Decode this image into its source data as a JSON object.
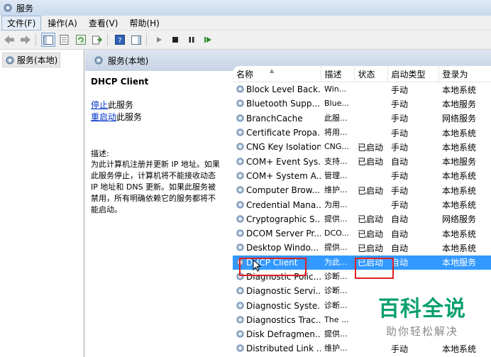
{
  "window": {
    "title": "服务"
  },
  "menu": [
    "文件(F)",
    "操作(A)",
    "查看(V)",
    "帮助(H)"
  ],
  "tree": {
    "item": "服务(本地)"
  },
  "content_header": {
    "title": "服务(本地)"
  },
  "detail": {
    "service_name": "DHCP Client",
    "stop_link": "停止",
    "stop_suffix": "此服务",
    "restart_link": "重启动",
    "restart_suffix": "此服务",
    "desc_label": "描述:",
    "desc_lines": [
      "为此计算机注册并更新 IP 地址。如果",
      "此服务停止，计算机将不能接收动态",
      "IP 地址和 DNS 更新。如果此服务被",
      "禁用，所有明确依赖它的服务都将不",
      "能启动。"
    ]
  },
  "table": {
    "headers": [
      "名称",
      "描述",
      "状态",
      "启动类型",
      "登录为"
    ],
    "rows": [
      [
        "Block Level Back...",
        "Win...",
        "",
        "手动",
        "本地系统"
      ],
      [
        "Bluetooth Supp...",
        "Blue...",
        "",
        "手动",
        "本地服务"
      ],
      [
        "BranchCache",
        "此服...",
        "",
        "手动",
        "网络服务"
      ],
      [
        "Certificate Propa...",
        "将用...",
        "",
        "手动",
        "本地系统"
      ],
      [
        "CNG Key Isolation",
        "CNG...",
        "已启动",
        "手动",
        "本地系统"
      ],
      [
        "COM+ Event Sys...",
        "支持...",
        "已启动",
        "自动",
        "本地服务"
      ],
      [
        "COM+ System A...",
        "管理...",
        "",
        "手动",
        "本地系统"
      ],
      [
        "Computer Brow...",
        "维护...",
        "已启动",
        "手动",
        "本地系统"
      ],
      [
        "Credential Mana...",
        "为用...",
        "",
        "手动",
        "本地系统"
      ],
      [
        "Cryptographic S...",
        "提供...",
        "已启动",
        "自动",
        "网络服务"
      ],
      [
        "DCOM Server Pr...",
        "DCO...",
        "已启动",
        "自动",
        "本地系统"
      ],
      [
        "Desktop Windo...",
        "提供...",
        "已启动",
        "自动",
        "本地系统"
      ],
      [
        "DHCP Client",
        "为此...",
        "已启动",
        "自动",
        "本地服务"
      ],
      [
        "Diagnostic Polic...",
        "诊断...",
        "",
        "",
        ""
      ],
      [
        "Diagnostic Servi...",
        "诊断...",
        "",
        "",
        ""
      ],
      [
        "Diagnostic Syste...",
        "诊断...",
        "",
        "",
        ""
      ],
      [
        "Diagnostics Trac...",
        "The ...",
        "",
        "",
        ""
      ],
      [
        "Disk Defragmen...",
        "提供...",
        "",
        "",
        ""
      ],
      [
        "Distributed Link ...",
        "维护...",
        "",
        "手动",
        "本地系统"
      ]
    ],
    "selected_index": 12
  },
  "watermark": {
    "big": "百科全说",
    "small": "助你轻松解决"
  },
  "colors": {
    "selection": "#3399ff",
    "highlight_box": "#e02020",
    "watermark": "#0aa06e",
    "link": "#0033cc"
  }
}
